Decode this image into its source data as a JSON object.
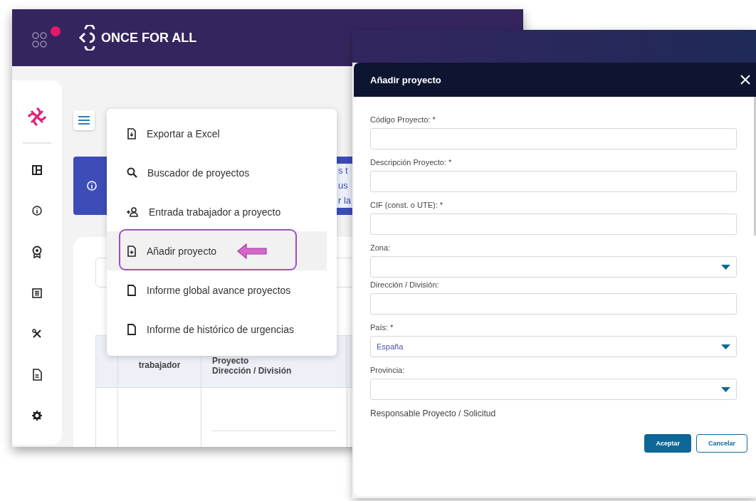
{
  "app_window": {
    "brand": "ONCE FOR ALL",
    "banner": {
      "lines": [
        "s t",
        "us",
        "r la"
      ]
    },
    "table": {
      "columns": [
        "trabajador",
        "Proyecto\nDirección / División"
      ]
    },
    "menu": {
      "items": [
        {
          "label": "Exportar a Excel",
          "kind": "export",
          "selected": false,
          "highlighted": false
        },
        {
          "label": "Buscador de proyectos",
          "kind": "search",
          "selected": false,
          "highlighted": false
        },
        {
          "label": "Entrada trabajador a proyecto",
          "kind": "user-add",
          "selected": false,
          "highlighted": false
        },
        {
          "label": "Añadir proyecto",
          "kind": "file-add",
          "selected": true,
          "highlighted": true
        },
        {
          "label": "Informe global avance proyectos",
          "kind": "file",
          "selected": false,
          "highlighted": false
        },
        {
          "label": "Informe de histórico de urgencias",
          "kind": "file",
          "selected": false,
          "highlighted": false
        }
      ]
    }
  },
  "dialog": {
    "title": "Añadir proyecto",
    "fields": [
      {
        "label": "Código Proyecto: *",
        "kind": "text"
      },
      {
        "label": "Descripción Proyecto: *",
        "kind": "text"
      },
      {
        "label": "CIF (const. o UTE): *",
        "kind": "text"
      },
      {
        "label": "Zona:",
        "kind": "select"
      },
      {
        "label": "Dirección / División:",
        "kind": "text"
      },
      {
        "label": "País: *",
        "kind": "select",
        "value": "España"
      },
      {
        "label": "Provincia:",
        "kind": "select"
      }
    ],
    "section_label": "Responsable Proyecto / Solicitud",
    "buttons": [
      {
        "label": "Aceptar",
        "kind": "primary"
      },
      {
        "label": "Cancelar",
        "kind": "secondary"
      }
    ]
  }
}
